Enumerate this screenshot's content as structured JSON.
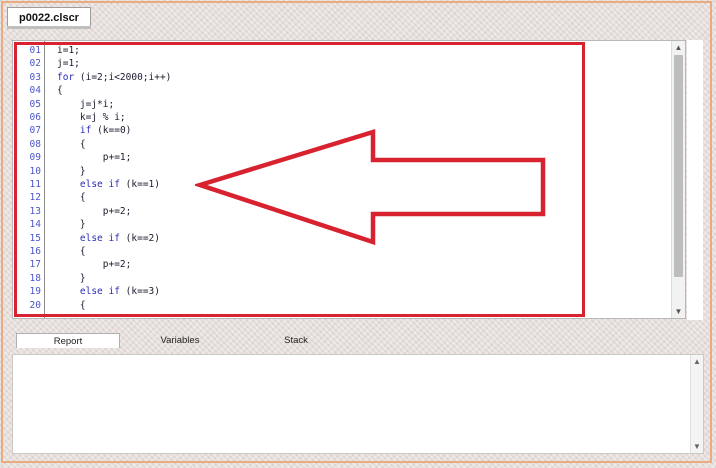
{
  "file_tab": {
    "label": "p0022.clscr"
  },
  "editor": {
    "lines": [
      {
        "num": "01",
        "parts": [
          {
            "t": "i=1;"
          }
        ]
      },
      {
        "num": "02",
        "parts": [
          {
            "t": "j=1;"
          }
        ]
      },
      {
        "num": "03",
        "parts": [
          {
            "t": "for",
            "kw": true
          },
          {
            "t": " (i=2;i<2000;i++)"
          }
        ]
      },
      {
        "num": "04",
        "parts": [
          {
            "t": "{"
          }
        ]
      },
      {
        "num": "05",
        "parts": [
          {
            "t": "    j=j*i;"
          }
        ]
      },
      {
        "num": "06",
        "parts": [
          {
            "t": "    k=j % i;"
          }
        ]
      },
      {
        "num": "07",
        "parts": [
          {
            "t": "    "
          },
          {
            "t": "if",
            "kw": true
          },
          {
            "t": " (k==0)"
          }
        ]
      },
      {
        "num": "08",
        "parts": [
          {
            "t": "    {"
          }
        ]
      },
      {
        "num": "09",
        "parts": [
          {
            "t": "        p+=1;"
          }
        ]
      },
      {
        "num": "10",
        "parts": [
          {
            "t": "    }"
          }
        ]
      },
      {
        "num": "11",
        "parts": [
          {
            "t": "    "
          },
          {
            "t": "else if",
            "kw": true
          },
          {
            "t": " (k==1)"
          }
        ]
      },
      {
        "num": "12",
        "parts": [
          {
            "t": "    {"
          }
        ]
      },
      {
        "num": "13",
        "parts": [
          {
            "t": "        p+=2;"
          }
        ]
      },
      {
        "num": "14",
        "parts": [
          {
            "t": "    }"
          }
        ]
      },
      {
        "num": "15",
        "parts": [
          {
            "t": "    "
          },
          {
            "t": "else if",
            "kw": true
          },
          {
            "t": " (k==2)"
          }
        ]
      },
      {
        "num": "16",
        "parts": [
          {
            "t": "    {"
          }
        ]
      },
      {
        "num": "17",
        "parts": [
          {
            "t": "        p+=2;"
          }
        ]
      },
      {
        "num": "18",
        "parts": [
          {
            "t": "    }"
          }
        ]
      },
      {
        "num": "19",
        "parts": [
          {
            "t": "    "
          },
          {
            "t": "else if",
            "kw": true
          },
          {
            "t": " (k==3)"
          }
        ]
      },
      {
        "num": "20",
        "parts": [
          {
            "t": "    {"
          }
        ]
      }
    ]
  },
  "bottom_tabs": [
    {
      "label": "Report",
      "active": true
    },
    {
      "label": "Variables",
      "active": false
    },
    {
      "label": "Stack",
      "active": false
    }
  ],
  "icons": {
    "scroll_up": "▲",
    "scroll_down": "▼"
  },
  "colors": {
    "highlight": "#d82230",
    "keyword": "#2b2bb8",
    "line_number": "#4b56c8",
    "frame": "#e9ab82"
  }
}
